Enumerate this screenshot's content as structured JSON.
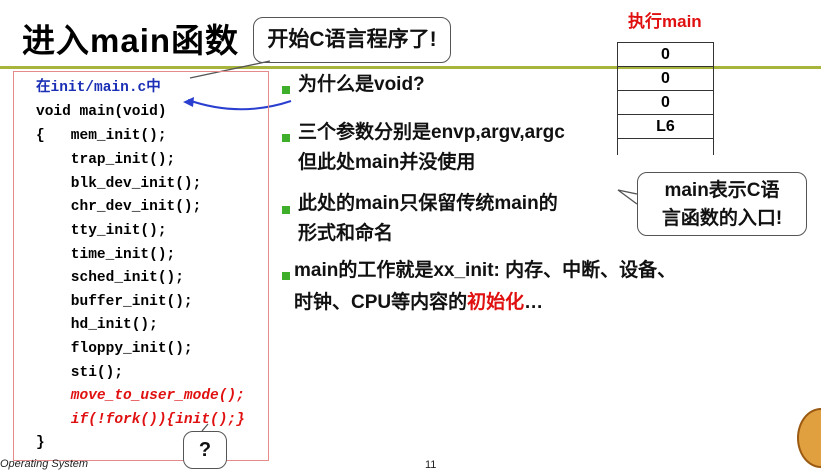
{
  "slide": {
    "title": "进入main函数",
    "callout_c": "开始C语言程序了!",
    "callout_main_line1": "main表示C语",
    "callout_main_line2": "言函数的入口!",
    "callout_q": "?",
    "footer_left": "Operating System",
    "footer_page": "11"
  },
  "code": {
    "file": "在init/main.c中",
    "lines": [
      "void main(void)",
      "{   mem_init();",
      "    trap_init();",
      "    blk_dev_init();",
      "    chr_dev_init();",
      "    tty_init();",
      "    time_init();",
      "    sched_init();",
      "    buffer_init();",
      "    hd_init();",
      "    floppy_init();",
      "    sti();",
      "    move_to_user_mode();",
      "    if(!fork()){init();}",
      "}"
    ]
  },
  "stack": {
    "label": "执行main",
    "cells": [
      "0",
      "0",
      "0",
      "L6"
    ]
  },
  "bullets": {
    "b1": "为什么是void?",
    "b2_line1": "三个参数分别是envp,argv,argc",
    "b2_line2": "但此处main并没使用",
    "b3_line1": "此处的main只保留传统main的",
    "b3_line2": "形式和命名",
    "b4_line1": "main的工作就是xx_init: 内存、中断、设备、",
    "b4_line2_prefix": "时钟、CPU等内容的",
    "b4_line2_highlight": "初始化",
    "b4_line2_suffix": "…"
  },
  "colors": {
    "accent_line": "#a8b53c",
    "bullet": "#3fae2a",
    "highlight": "#e01010",
    "file_text": "#1a2fb5",
    "code_box_border": "#e58b8b",
    "arrow": "#2a3fd0"
  }
}
